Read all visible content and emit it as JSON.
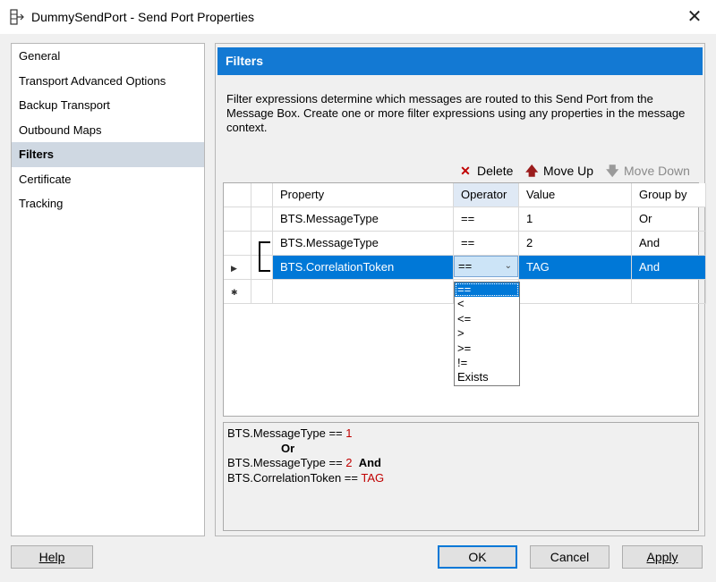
{
  "window": {
    "title": "DummySendPort - Send Port Properties",
    "close_glyph": "✕"
  },
  "nav": {
    "items": [
      {
        "label": "General",
        "selected": false
      },
      {
        "label": "Transport Advanced Options",
        "selected": false
      },
      {
        "label": "Backup Transport",
        "selected": false
      },
      {
        "label": "Outbound Maps",
        "selected": false
      },
      {
        "label": "Filters",
        "selected": true
      },
      {
        "label": "Certificate",
        "selected": false
      },
      {
        "label": "Tracking",
        "selected": false
      }
    ]
  },
  "panel": {
    "title": "Filters",
    "description": "Filter expressions determine which messages are routed to this Send Port from the Message Box. Create one or more filter expressions using any properties in the message context."
  },
  "toolbar": {
    "delete_label": "Delete",
    "move_up_label": "Move Up",
    "move_down_label": "Move Down",
    "delete_color": "#c00000",
    "move_up_color": "#9b1c1c",
    "move_down_color": "#9a9a9a"
  },
  "grid": {
    "columns": [
      "Property",
      "Operator",
      "Value",
      "Group by"
    ],
    "rows": [
      {
        "property": "BTS.MessageType",
        "operator": "==",
        "value": "1",
        "group_by": "Or"
      },
      {
        "property": "BTS.MessageType",
        "operator": "==",
        "value": "2",
        "group_by": "And"
      },
      {
        "property": "BTS.CorrelationToken",
        "operator": "==",
        "value": "TAG",
        "group_by": "And"
      }
    ],
    "current_row_marker": "▶",
    "new_row_marker": "✱"
  },
  "operator_dropdown": {
    "options": [
      "==",
      "<",
      "<=",
      ">",
      ">=",
      "!=",
      "Exists"
    ],
    "highlighted": "=="
  },
  "expression": {
    "line1_prop": "BTS.MessageType",
    "line1_op": " == ",
    "line1_val": "1",
    "line2_group": "Or",
    "line3_prop": "BTS.MessageType",
    "line3_op": " == ",
    "line3_val": "2",
    "line3_group": "And",
    "line4_prop": "BTS.CorrelationToken",
    "line4_op": " == ",
    "line4_val": "TAG"
  },
  "buttons": {
    "help": "Help",
    "ok": "OK",
    "cancel": "Cancel",
    "apply": "Apply"
  }
}
